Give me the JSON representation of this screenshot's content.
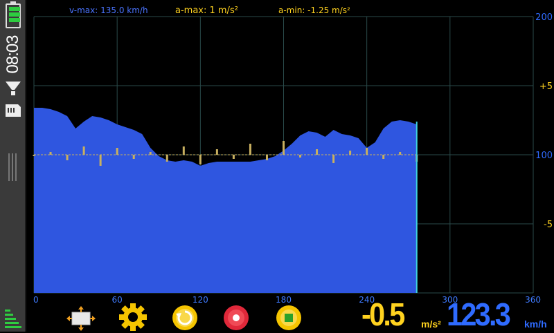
{
  "status": {
    "time": "08:03",
    "icons": [
      "battery-icon",
      "signal-icon",
      "sd-card-icon",
      "network-strength-icon"
    ]
  },
  "stats": {
    "vmax": "v-max: 135.0 km/h",
    "amax": "a-max: 1 m/s²",
    "amin": "a-min: -1.25 m/s²"
  },
  "colors": {
    "speed": "#2f56e0",
    "accel": "#c8b060",
    "accent_yellow": "#ffd21f",
    "accent_blue": "#2f6bff",
    "grid": "#2a4a4a",
    "cursor": "#40d0e0"
  },
  "chart_data": {
    "type": "area",
    "x_ticks": [
      "0",
      "60",
      "120",
      "180",
      "240",
      "300",
      "360"
    ],
    "xlim": [
      0,
      360
    ],
    "right_ticks": [
      {
        "text": "200",
        "color": "blue"
      },
      {
        "text": "+5",
        "color": "yellow"
      },
      {
        "text": "100",
        "color": "blue"
      },
      {
        "text": "-5",
        "color": "yellow"
      }
    ],
    "speed_ylim": [
      0,
      200
    ],
    "accel_ylim": [
      -10,
      10
    ],
    "cursor_x": 276,
    "series": [
      {
        "color": "#2f56e0",
        "x": [
          0,
          6,
          12,
          18,
          24,
          30,
          36,
          42,
          48,
          54,
          60,
          66,
          72,
          78,
          84,
          90,
          96,
          102,
          108,
          114,
          120,
          126,
          132,
          138,
          144,
          150,
          156,
          162,
          168,
          174,
          180,
          186,
          192,
          198,
          204,
          210,
          216,
          222,
          228,
          234,
          240,
          246,
          252,
          258,
          264,
          270,
          276
        ],
        "values": [
          134,
          134,
          133,
          131,
          128,
          119,
          124,
          128,
          127,
          125,
          122,
          120,
          118,
          115,
          105,
          99,
          96,
          95,
          96,
          95,
          92,
          94,
          95,
          95,
          95,
          95,
          95,
          96,
          97,
          99,
          103,
          108,
          114,
          117,
          116,
          113,
          118,
          115,
          114,
          112,
          105,
          109,
          119,
          124,
          125,
          124,
          122
        ]
      },
      {
        "color": "#c8b060",
        "x": [
          0,
          12,
          24,
          36,
          48,
          60,
          72,
          84,
          96,
          108,
          120,
          132,
          144,
          156,
          168,
          180,
          192,
          204,
          216,
          228,
          240,
          252,
          264,
          276
        ],
        "values": [
          0,
          0.2,
          -0.4,
          0.6,
          -0.8,
          0.5,
          -0.3,
          0.2,
          -0.5,
          0.6,
          -0.7,
          0.4,
          -0.3,
          0.8,
          -0.4,
          1.0,
          -0.2,
          0.4,
          -0.6,
          0.3,
          0.5,
          -0.3,
          0.2,
          -0.5
        ]
      }
    ]
  },
  "controls": {
    "icons": [
      "move-icon",
      "gear-icon",
      "reset-icon",
      "record-icon",
      "stop-icon"
    ]
  },
  "readout": {
    "accel_value": "-0.5",
    "accel_unit": "m/s²",
    "speed_value": "123.3",
    "speed_unit": "km/h"
  }
}
